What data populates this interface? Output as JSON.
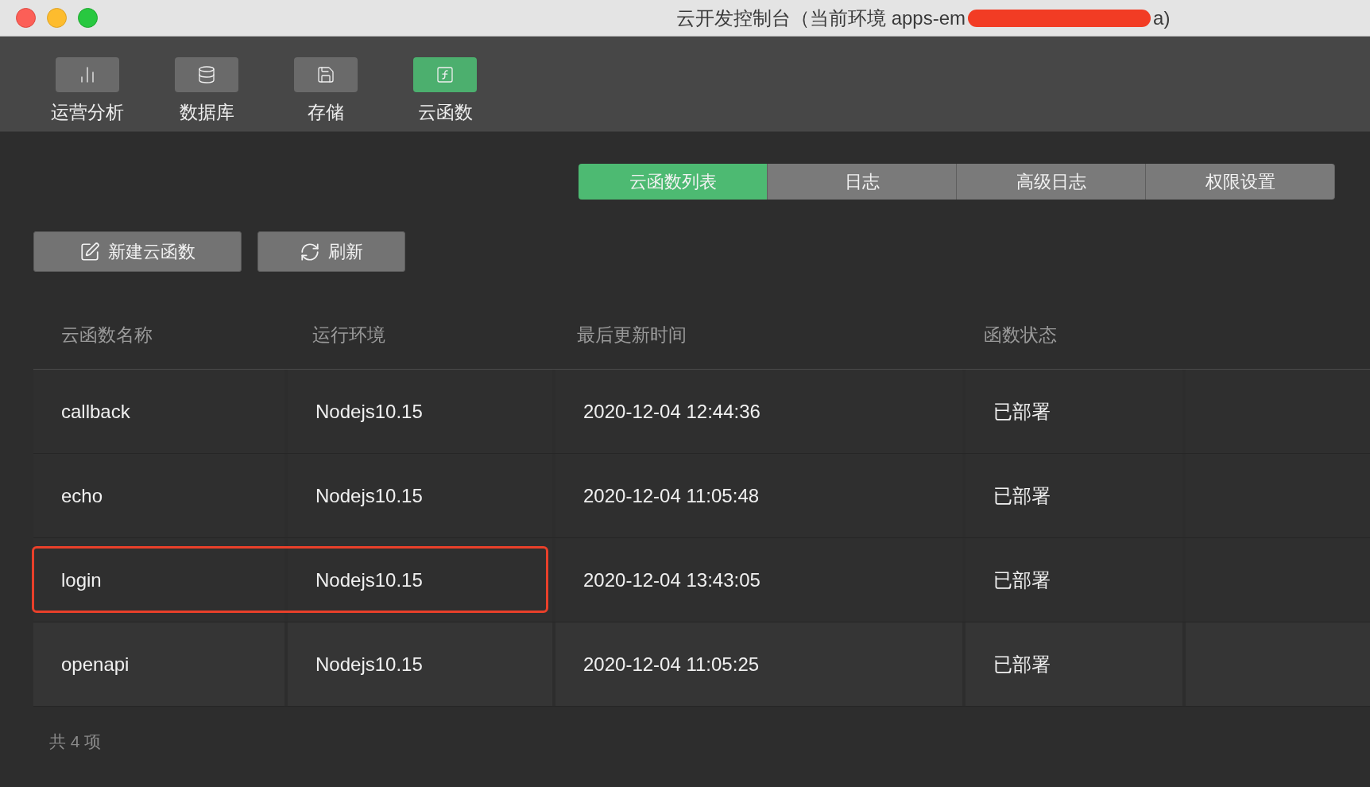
{
  "window": {
    "title_start": "云开发控制台（当前环境 apps-em",
    "title_end": "a)",
    "redacted": true
  },
  "toolbar": [
    {
      "kind": "chart",
      "label": "运营分析",
      "selected": false
    },
    {
      "kind": "database",
      "label": "数据库",
      "selected": false
    },
    {
      "kind": "storage",
      "label": "存储",
      "selected": false
    },
    {
      "kind": "function",
      "label": "云函数",
      "selected": true
    }
  ],
  "tabs": [
    {
      "label": "云函数列表",
      "selected": true
    },
    {
      "label": "日志",
      "selected": false
    },
    {
      "label": "高级日志",
      "selected": false
    },
    {
      "label": "权限设置",
      "selected": false
    }
  ],
  "actions": [
    {
      "kind": "new",
      "label": "新建云函数"
    },
    {
      "kind": "refresh",
      "label": "刷新"
    }
  ],
  "table": {
    "columns": [
      "云函数名称",
      "运行环境",
      "最后更新时间",
      "函数状态"
    ],
    "rows": [
      {
        "name": "callback",
        "runtime": "Nodejs10.15",
        "updated": "2020-12-04 12:44:36",
        "status": "已部署",
        "highlighted": false
      },
      {
        "name": "echo",
        "runtime": "Nodejs10.15",
        "updated": "2020-12-04 11:05:48",
        "status": "已部署",
        "highlighted": false
      },
      {
        "name": "login",
        "runtime": "Nodejs10.15",
        "updated": "2020-12-04 13:43:05",
        "status": "已部署",
        "highlighted": true
      },
      {
        "name": "openapi",
        "runtime": "Nodejs10.15",
        "updated": "2020-12-04 11:05:25",
        "status": "已部署",
        "highlighted": false
      }
    ]
  },
  "footer": "共 4 项"
}
